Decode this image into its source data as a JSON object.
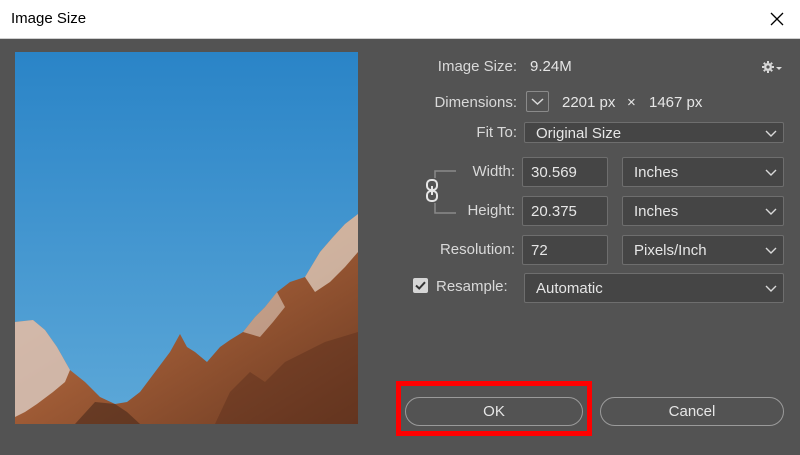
{
  "window": {
    "title": "Image Size"
  },
  "info": {
    "image_size_label": "Image Size:",
    "image_size_value": "9.24M",
    "dimensions_label": "Dimensions:",
    "dim_width": "2201 px",
    "dim_times": "×",
    "dim_height": "1467 px"
  },
  "fit_to": {
    "label": "Fit To:",
    "value": "Original Size"
  },
  "width": {
    "label": "Width:",
    "value": "30.569",
    "unit": "Inches"
  },
  "height": {
    "label": "Height:",
    "value": "20.375",
    "unit": "Inches"
  },
  "resolution": {
    "label": "Resolution:",
    "value": "72",
    "unit": "Pixels/Inch"
  },
  "resample": {
    "label": "Resample:",
    "value": "Automatic",
    "checked": true
  },
  "buttons": {
    "ok": "OK",
    "cancel": "Cancel"
  },
  "colors": {
    "dialog_bg": "#535353",
    "field_bg": "#454545",
    "highlight": "#ff0000"
  },
  "icons": [
    "close-icon",
    "gear-icon",
    "chevron-down-icon",
    "link-icon",
    "checkmark-icon"
  ]
}
